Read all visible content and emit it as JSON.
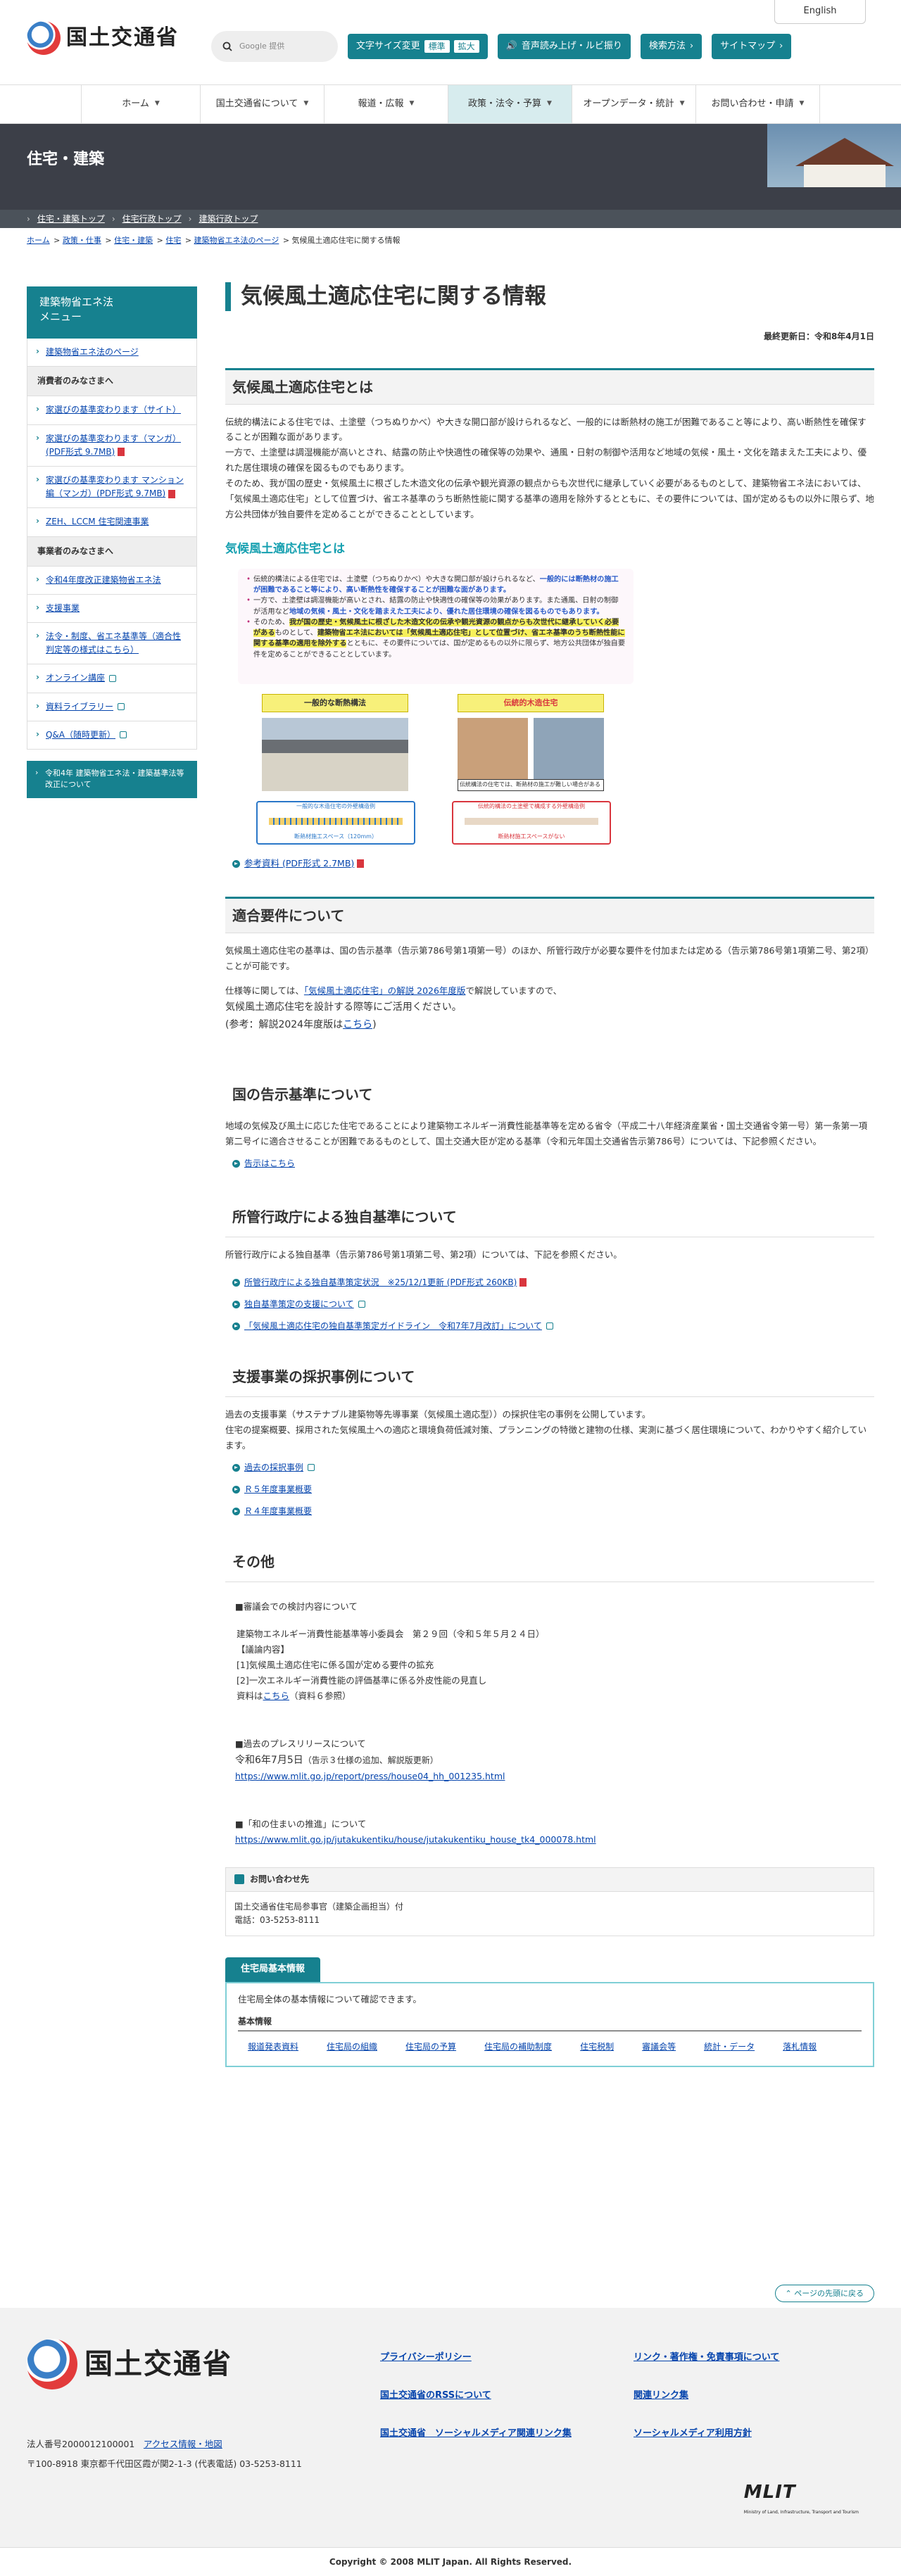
{
  "header": {
    "logo_text": "国土交通省",
    "language": "English",
    "search_placeholder": "Google 提供",
    "text_size_label": "文字サイズ変更",
    "text_size_standard": "標準",
    "text_size_large": "拡大",
    "voice_label": "音声読み上げ・ルビ振り",
    "search_method": "検索方法",
    "sitemap": "サイトマップ"
  },
  "nav": [
    {
      "label": "ホーム"
    },
    {
      "label": "国土交通省について"
    },
    {
      "label": "報道・広報"
    },
    {
      "label": "政策・法令・予算"
    },
    {
      "label": "オープンデータ・統計"
    },
    {
      "label": "お問い合わせ・申請"
    }
  ],
  "banner": {
    "title": "住宅・建築",
    "links": [
      "住宅・建築トップ",
      "住宅行政トップ",
      "建築行政トップ"
    ]
  },
  "breadcrumb": [
    "ホーム",
    "政策・仕事",
    "住宅・建築",
    "住宅",
    "建築物省エネ法のページ",
    "気候風土適応住宅に関する情報"
  ],
  "sidebar": {
    "title": "建築物省エネ法\nメニュー",
    "top_link": "建築物省エネ法のページ",
    "cat1": "消費者のみなさまへ",
    "consumer_items": [
      "家選びの基準変わります（サイト）",
      "家選びの基準変わります（マンガ）(PDF形式 9.7MB)",
      "家選びの基準変わります マンション編（マンガ）(PDF形式 9.7MB)",
      "ZEH、LCCM 住宅関連事業"
    ],
    "cat2": "事業者のみなさまへ",
    "business_items": [
      "令和4年度改正建築物省エネ法",
      "支援事業",
      "法令・制度、省エネ基準等（適合性判定等の様式はこちら）",
      "オンライン講座",
      "資料ライブラリー",
      "Q&A（随時更新）"
    ],
    "bottom_button": "令和4年 建築物省エネ法・建築基準法等改正について"
  },
  "page": {
    "title": "気候風土適応住宅に関する情報",
    "updated": "最終更新日：令和8年4月1日"
  },
  "sec1": {
    "heading": "気候風土適応住宅とは",
    "p1": "伝統的構法による住宅では、土塗壁（つちぬりかべ）や大きな開口部が設けられるなど、一般的には断熱材の施工が困難であること等により、高い断熱性を確保することが困難な面があります。",
    "p2": "一方で、土塗壁は調湿機能が高いとされ、結露の防止や快適性の確保等の効果や、通風・日射の制御や活用など地域の気候・風土・文化を踏まえた工夫により、優れた居住環境の確保を図るものでもあります。",
    "p3": "そのため、我が国の歴史・気候風土に根ざした木造文化の伝承や観光資源の観点からも次世代に継承していく必要があるものとして、建築物省エネ法においては、「気候風土適応住宅」として位置づけ、省エネ基準のうち断熱性能に関する基準の適用を除外するとともに、その要件については、国が定めるもの以外に限らず、地方公共団体が独自要件を定めることができることとしています。",
    "fig_title": "気候風土適応住宅とは",
    "fig_b1a": "伝統的構法による住宅では、土塗壁（つちぬりかべ）や大きな開口部が設けられるなど、",
    "fig_b1b": "一般的には断熱材の施工が困難であること等により、高い断熱性を確保することが困難な面があります。",
    "fig_b2a": "一方で、土塗壁は調湿機能が高いとされ、結露の防止や快適性の確保等の効果があります。また通風、日射の制御が活用など",
    "fig_b2b": "地域の気候・風土・文化を踏まえた工夫により、優れた居住環境の確保を図るものでもあります。",
    "fig_b3a": "そのため、",
    "fig_b3b": "我が国の歴史・気候風土に根ざした木造文化の伝承や観光資源の観点からも次世代に継承していく必要がある",
    "fig_b3c": "ものとして、",
    "fig_b3d": "建築物省エネ法においては「気候風土適応住宅」として位置づけ、省エネ基準のうち断熱性能に関する基準の適用を除外する",
    "fig_b3e": "とともに、その要件については、国が定めるもの以外に限らず、地方公共団体が独自要件を定めることができることとしています。",
    "fig_label1": "一般的な断熱構法",
    "fig_label2": "伝統的木造住宅",
    "fig_cap2": "伝統構法の住宅では、断熱材の施工が難しい場合がある",
    "fig_d1a": "一般的な木造住宅の外壁構造例",
    "fig_d1b": "断熱材施工スペース（120mm）",
    "fig_d2a": "伝統的構法の土塗壁で構成する外壁構造例",
    "fig_d2b": "断熱材施工スペースがない",
    "ref_link": "参考資料 (PDF形式 2.7MB)"
  },
  "sec2": {
    "heading": "適合要件について",
    "p1": "気候風土適応住宅の基準は、国の告示基準（告示第786号第1項第一号）のほか、所管行政庁が必要な要件を付加または定める（告示第786号第1項第二号、第2項）ことが可能です。",
    "p2a": "仕様等に関しては、",
    "p2link": "「気候風土適応住宅」の解説 2026年度版",
    "p2b": "で解説していますので、",
    "p3": "気候風土適応住宅を設計する際等にご活用ください。",
    "p4a": "(参考：解説2024年度版は",
    "p4link": "こちら",
    "p4b": ")"
  },
  "sec3": {
    "heading": "国の告示基準について",
    "p1": "地域の気候及び風土に応じた住宅であることにより建築物エネルギー消費性能基準等を定める省令（平成二十八年経済産業省・国土交通省令第一号）第一条第一項第二号イに適合させることが困難であるものとして、国土交通大臣が定める基準（令和元年国土交通省告示第786号）については、下記参照ください。",
    "link": "告示はこちら"
  },
  "sec4": {
    "heading": "所管行政庁による独自基準について",
    "p1": "所管行政庁による独自基準（告示第786号第1項第二号、第2項）については、下記を参照ください。",
    "links": [
      "所管行政庁による独自基準策定状況　※25/12/1更新 (PDF形式 260KB)",
      "独自基準策定の支援について",
      "「気候風土適応住宅の独自基準策定ガイドライン　令和7年7月改訂」について"
    ]
  },
  "sec5": {
    "heading": "支援事業の採択事例について",
    "p1": "過去の支援事業（サステナブル建築物等先導事業（気候風土適応型））の採択住宅の事例を公開しています。",
    "p2": "住宅の提案概要、採用された気候風土への適応と環境負荷低減対策、プランニングの特徴と建物の仕様、実測に基づく居住環境について、わかりやすく紹介しています。",
    "links": [
      "過去の採択事例",
      "Ｒ５年度事業概要",
      "Ｒ４年度事業概要"
    ]
  },
  "sec6": {
    "heading": "その他",
    "b1_title": "■審議会での検討内容について",
    "b1_l1": "建築物エネルギー消費性能基準等小委員会　第２９回（令和５年５月２４日）",
    "b1_l2": "【議論内容】",
    "b1_l3": "[1]気候風土適応住宅に係る国が定める要件の拡充",
    "b1_l4": "[2]一次エネルギー消費性能の評価基準に係る外皮性能の見直し",
    "b1_l5a": "資料は",
    "b1_link": "こちら",
    "b1_l5b": "（資料６参照）",
    "b2_title": "■過去のプレスリリースについて",
    "b2_l1": "令和6年7月5日",
    "b2_l1b": "（告示３仕様の追加、解説版更新）",
    "b2_url": "https://www.mlit.go.jp/report/press/house04_hh_001235.html",
    "b3_title": "■「和の住まいの推進」について",
    "b3_url": "https://www.mlit.go.jp/jutakukentiku/house/jutakukentiku_house_tk4_000078.html"
  },
  "contact": {
    "heading": "お問い合わせ先",
    "l1": "国土交通省住宅局参事官（建築企画担当）付",
    "l2": "電話：03-5253-8111"
  },
  "basic_info": {
    "tab": "住宅局基本情報",
    "lead": "住宅局全体の基本情報について確認できます。",
    "sub": "基本情報",
    "links": [
      "報道発表資料",
      "住宅局の組織",
      "住宅局の予算",
      "住宅局の補助制度",
      "住宅税制",
      "審議会等",
      "統計・データ",
      "落札情報"
    ]
  },
  "to_top": "ページの先頭に戻る",
  "footer": {
    "logo_text": "国土交通省",
    "corp_no": "法人番号2000012100001",
    "access": "アクセス情報・地図",
    "address": "〒100-8918 東京都千代田区霞が関2-1-3 (代表電話) 03-5253-8111",
    "links": [
      "プライバシーポリシー",
      "リンク・著作権・免責事項について",
      "国土交通省のRSSについて",
      "関連リンク集",
      "国土交通省　ソーシャルメディア関連リンク集",
      "ソーシャルメディア利用方針"
    ],
    "mlit": "MLIT",
    "mlit_sub": "Ministry of Land, Infrastructure, Transport and Tourism",
    "copyright": "Copyright © 2008 MLIT Japan. All Rights Reserved."
  }
}
